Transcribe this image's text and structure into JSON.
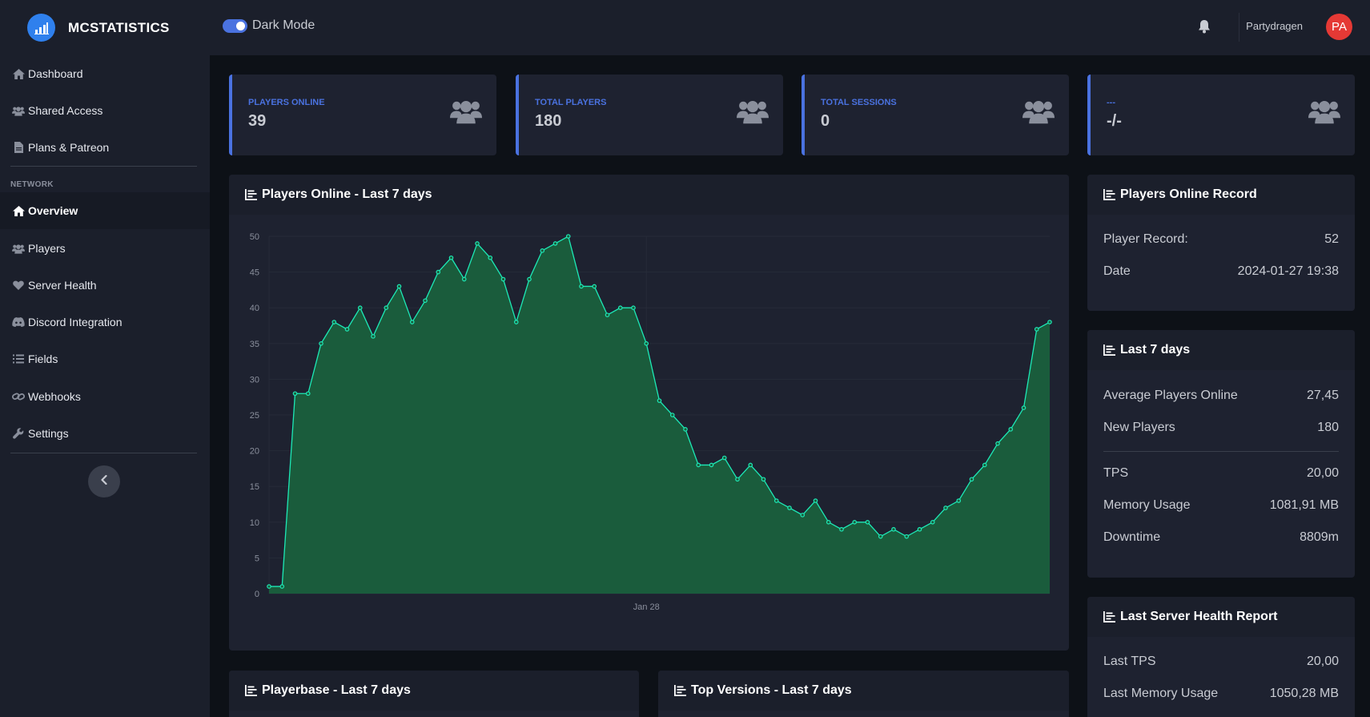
{
  "brand": {
    "name": "MCSTATISTICS",
    "logo_icon": "bar-chart-icon",
    "accent": "#2f80ed"
  },
  "header": {
    "dark_mode_label": "Dark Mode",
    "dark_mode_on": true,
    "notification_icon": "bell-icon",
    "username": "Partydragen",
    "avatar_initials": "PA",
    "avatar_color": "#e53935"
  },
  "sidebar": {
    "items": [
      {
        "label": "Dashboard",
        "icon": "home-icon"
      },
      {
        "label": "Shared Access",
        "icon": "users-icon"
      },
      {
        "label": "Plans & Patreon",
        "icon": "document-icon"
      }
    ],
    "network_label": "NETWORK",
    "network_items": [
      {
        "label": "Overview",
        "icon": "home-icon",
        "active": true
      },
      {
        "label": "Players",
        "icon": "users-icon"
      },
      {
        "label": "Server Health",
        "icon": "heart-icon"
      },
      {
        "label": "Discord Integration",
        "icon": "discord-icon"
      },
      {
        "label": "Fields",
        "icon": "list-icon"
      },
      {
        "label": "Webhooks",
        "icon": "link-icon"
      },
      {
        "label": "Settings",
        "icon": "wrench-icon"
      }
    ],
    "collapse_icon": "chevron-left-icon"
  },
  "stats": [
    {
      "label": "PLAYERS ONLINE",
      "value": "39",
      "icon": "users-icon"
    },
    {
      "label": "TOTAL PLAYERS",
      "value": "180",
      "icon": "users-icon"
    },
    {
      "label": "TOTAL SESSIONS",
      "value": "0",
      "icon": "users-icon"
    },
    {
      "label": "---",
      "value": "-/-",
      "icon": "users-icon"
    }
  ],
  "main_chart": {
    "title": "Players Online - Last 7 days",
    "icon": "chart-icon"
  },
  "chart_data": {
    "type": "area",
    "title": "Players Online - Last 7 days",
    "xlabel": "",
    "ylabel": "",
    "ylim": [
      0,
      50
    ],
    "yticks": [
      0,
      5,
      10,
      15,
      20,
      25,
      30,
      35,
      40,
      45,
      50
    ],
    "x_tick_labels": [
      {
        "index": 29,
        "label": "Jan 28"
      }
    ],
    "grid": true,
    "line_color": "#1de9b6",
    "fill_color": "#1a5c3c",
    "series": [
      {
        "values": [
          1,
          1,
          28,
          28,
          35,
          38,
          37,
          40,
          36,
          40,
          43,
          38,
          41,
          45,
          47,
          44,
          49,
          47,
          44,
          38,
          44,
          48,
          49,
          50,
          43,
          43,
          39,
          40,
          40,
          35,
          27,
          25,
          23,
          18,
          18,
          19,
          16,
          18,
          16,
          13,
          12,
          11,
          13,
          10,
          9,
          10,
          10,
          8,
          9,
          8,
          9,
          10,
          12,
          13,
          16,
          18,
          21,
          23,
          26,
          37,
          38
        ]
      }
    ]
  },
  "record_panel": {
    "title": "Players Online Record",
    "rows": [
      {
        "label": "Player Record:",
        "value": "52"
      },
      {
        "label": "Date",
        "value": "2024-01-27 19:38"
      }
    ]
  },
  "last7_panel": {
    "title": "Last 7 days",
    "rows": [
      {
        "label": "Average Players Online",
        "value": "27,45"
      },
      {
        "label": "New Players",
        "value": "180"
      }
    ],
    "rows2": [
      {
        "label": "TPS",
        "value": "20,00"
      },
      {
        "label": "Memory Usage",
        "value": "1081,91 MB"
      },
      {
        "label": "Downtime",
        "value": "8809m"
      }
    ]
  },
  "health_panel": {
    "title": "Last Server Health Report",
    "rows": [
      {
        "label": "Last TPS",
        "value": "20,00"
      },
      {
        "label": "Last Memory Usage",
        "value": "1050,28 MB"
      }
    ]
  },
  "playerbase_panel": {
    "title": "Playerbase - Last 7 days"
  },
  "versions_panel": {
    "title": "Top Versions - Last 7 days"
  }
}
